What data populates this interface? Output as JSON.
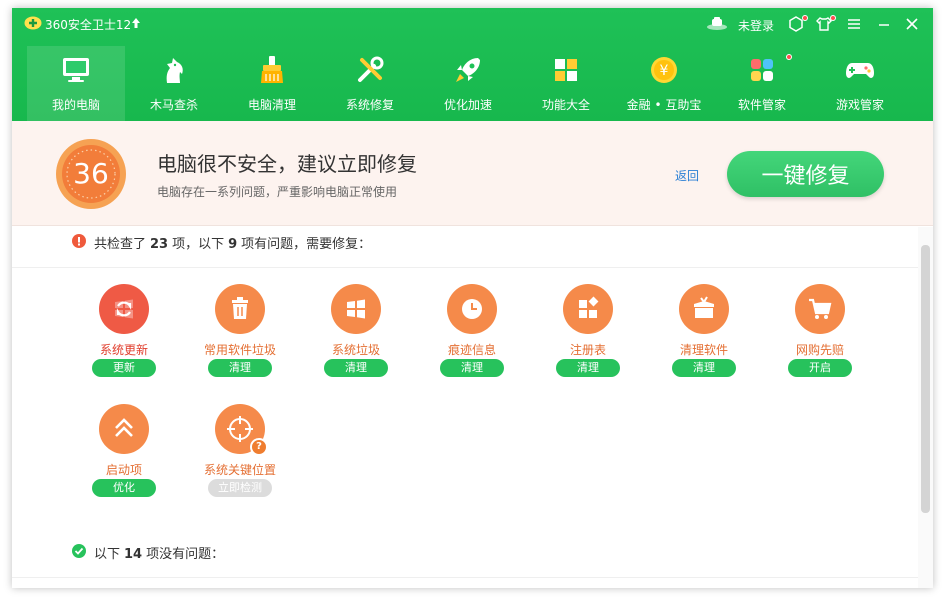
{
  "app": {
    "title": "360安全卫士12",
    "login_status": "未登录"
  },
  "nav": [
    {
      "label": "我的电脑",
      "icon": "monitor-icon",
      "active": true
    },
    {
      "label": "木马查杀",
      "icon": "horse-icon"
    },
    {
      "label": "电脑清理",
      "icon": "broom-icon"
    },
    {
      "label": "系统修复",
      "icon": "tools-icon"
    },
    {
      "label": "优化加速",
      "icon": "rocket-icon"
    },
    {
      "label": "功能大全",
      "icon": "grid-icon"
    },
    {
      "label": "金融 • 互助宝",
      "icon": "coin-icon"
    },
    {
      "label": "软件管家",
      "icon": "apps-icon"
    },
    {
      "label": "游戏管家",
      "icon": "gamepad-icon"
    }
  ],
  "banner": {
    "score": "36",
    "title": "电脑很不安全，建议立即修复",
    "subtitle": "电脑存在一系列问题，严重影响电脑正常使用",
    "back_label": "返回",
    "fix_label": "一键修复"
  },
  "summary": {
    "prefix": "共检查了",
    "total": "23",
    "mid": "项，以下",
    "problems": "9",
    "suffix": "项有问题，需要修复："
  },
  "issues": [
    {
      "label": "系统更新",
      "button": "更新",
      "icon": "windows-update-icon"
    },
    {
      "label": "常用软件垃圾",
      "button": "清理",
      "icon": "trash-icon"
    },
    {
      "label": "系统垃圾",
      "button": "清理",
      "icon": "windows-icon"
    },
    {
      "label": "痕迹信息",
      "button": "清理",
      "icon": "clock-icon"
    },
    {
      "label": "注册表",
      "button": "清理",
      "icon": "registry-icon"
    },
    {
      "label": "清理软件",
      "button": "清理",
      "icon": "box-icon"
    },
    {
      "label": "网购先赔",
      "button": "开启",
      "icon": "cart-icon"
    },
    {
      "label": "启动项",
      "button": "优化",
      "icon": "chevron-up-icon"
    },
    {
      "label": "系统关键位置",
      "button": "立即检测",
      "icon": "target-icon"
    }
  ],
  "ok_summary": {
    "prefix": "以下",
    "count": "14",
    "suffix": "项没有问题："
  },
  "colors": {
    "header_green": "#1fc157",
    "issue_orange": "#f58a4a",
    "issue_red": "#ef5a45",
    "button_green": "#27c25c"
  }
}
